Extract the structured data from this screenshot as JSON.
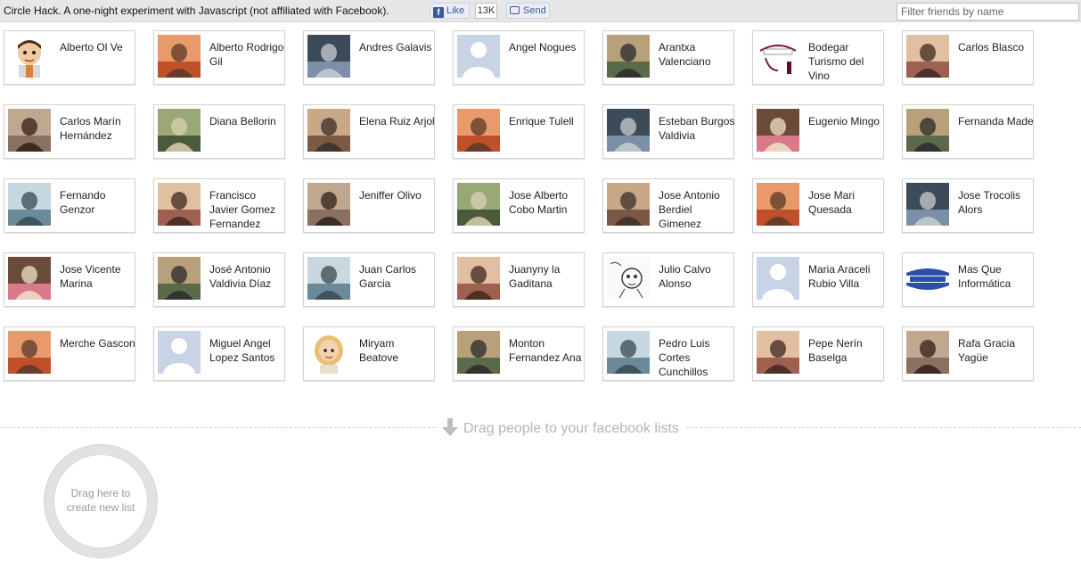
{
  "header": {
    "intro": "Circle Hack. A one-night experiment with Javascript (not affiliated with Facebook).",
    "like_label": "Like",
    "like_count": "13K",
    "send_label": "Send",
    "filter_placeholder": "Filter friends by name"
  },
  "friends": [
    {
      "name": "Alberto Ol Ve",
      "photo": "cartoon-man-icon"
    },
    {
      "name": "Alberto Rodrigo Gil",
      "photo": "photo"
    },
    {
      "name": "Andres Galavis",
      "photo": "photo"
    },
    {
      "name": "Angel Nogues",
      "photo": "default-avatar-icon"
    },
    {
      "name": "Arantxa Valenciano",
      "photo": "photo"
    },
    {
      "name": "Bodegar Turismo del Vino",
      "photo": "logo"
    },
    {
      "name": "Carlos Blasco",
      "photo": "photo"
    },
    {
      "name": "Carlos Marín Hernández",
      "photo": "photo"
    },
    {
      "name": "Diana Bellorin",
      "photo": "photo"
    },
    {
      "name": "Elena Ruiz Arjol",
      "photo": "photo"
    },
    {
      "name": "Enrique Tulell",
      "photo": "photo"
    },
    {
      "name": "Esteban Burgos Valdivia",
      "photo": "photo"
    },
    {
      "name": "Eugenio Mingo",
      "photo": "photo"
    },
    {
      "name": "Fernanda Made",
      "photo": "photo"
    },
    {
      "name": "Fernando Genzor",
      "photo": "photo"
    },
    {
      "name": "Francisco Javier Gomez Fernandez",
      "photo": "photo"
    },
    {
      "name": "Jeniffer Olivo",
      "photo": "photo"
    },
    {
      "name": "Jose Alberto Cobo Martin",
      "photo": "photo"
    },
    {
      "name": "Jose Antonio Berdiel Gimenez",
      "photo": "photo"
    },
    {
      "name": "Jose Mari Quesada",
      "photo": "photo"
    },
    {
      "name": "Jose Trocolis Alors",
      "photo": "photo"
    },
    {
      "name": "Jose Vicente Marina",
      "photo": "photo"
    },
    {
      "name": "José Antonio Valdivia Díaz",
      "photo": "photo"
    },
    {
      "name": "Juan Carlos Garcia",
      "photo": "photo"
    },
    {
      "name": "Juanyny la Gaditana",
      "photo": "photo"
    },
    {
      "name": "Julio Calvo Alonso",
      "photo": "sketch"
    },
    {
      "name": "Maria Araceli Rubio Villa",
      "photo": "default-avatar-icon"
    },
    {
      "name": "Mas Que Informática",
      "photo": "logo"
    },
    {
      "name": "Merche Gascon",
      "photo": "photo"
    },
    {
      "name": "Miguel Angel Lopez Santos",
      "photo": "default-avatar-icon"
    },
    {
      "name": "Miryam Beatove",
      "photo": "cartoon-woman-icon"
    },
    {
      "name": "Monton Fernandez Ana",
      "photo": "photo"
    },
    {
      "name": "Pedro Luis Cortes Cunchillos",
      "photo": "photo"
    },
    {
      "name": "Pepe Nerín Baselga",
      "photo": "photo"
    },
    {
      "name": "Rafa Gracia Yagüe",
      "photo": "photo"
    }
  ],
  "dropzone": {
    "label": "Drag people to your facebook lists",
    "arrow_icon": "arrow-down-icon",
    "new_list_line1": "Drag here to",
    "new_list_line2": "create new list"
  },
  "colors": {
    "facebook_blue": "#3b5998",
    "topbar_bg": "#e7e7e7",
    "muted_text": "#b5b5b5"
  }
}
